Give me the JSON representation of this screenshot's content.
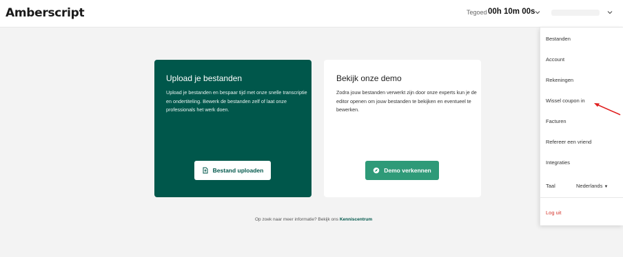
{
  "header": {
    "logo": "Amberscript",
    "credit_label": "Tegoed",
    "credit_value": "00h 10m 00s"
  },
  "upload_card": {
    "title": "Upload je bestanden",
    "description": "Upload je bestanden en bespaar tijd met onze snelle transcriptie en ondertiteling. Bewerk de bestanden zelf of laat onze professionals het werk doen.",
    "button_label": "Bestand uploaden",
    "button_icon": "file-upload-icon"
  },
  "demo_card": {
    "title": "Bekijk onze demo",
    "description": "Zodra jouw bestanden verwerkt zijn door onze experts kun je de editor openen om jouw bestanden te bekijken en eventueel te bewerken.",
    "button_label": "Demo verkennen",
    "button_icon": "compass-icon"
  },
  "footer": {
    "text": "Op zoek naar meer informatie? Bekijk ons",
    "link": "Kenniscentrum"
  },
  "menu": {
    "items": [
      "Bestanden",
      "Account",
      "Rekeningen",
      "Wissel coupon in",
      "Facturen",
      "Refereer een vriend",
      "Integraties"
    ],
    "language_label": "Taal",
    "language_value": "Nederlands",
    "logout": "Log uit"
  },
  "colors": {
    "brand_dark_green": "#00574b",
    "button_green": "#2e9a78",
    "logout_red": "#d5342b",
    "arrow_red": "#e02020"
  }
}
